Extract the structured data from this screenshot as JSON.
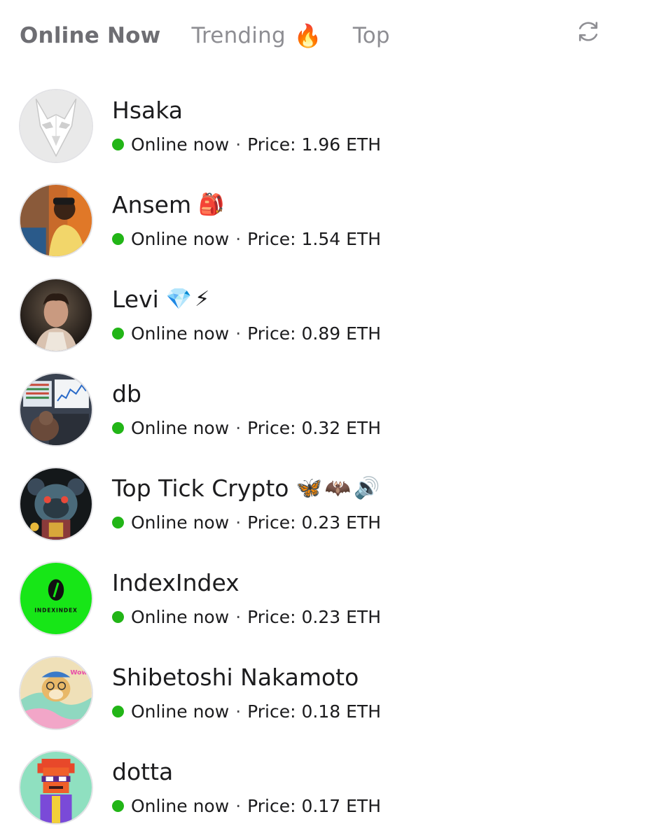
{
  "tabs": [
    {
      "label": "Online Now",
      "emoji": "",
      "active": true
    },
    {
      "label": "Trending",
      "emoji": "🔥",
      "active": false
    },
    {
      "label": "Top",
      "emoji": "",
      "active": false
    }
  ],
  "refresh_icon": "refresh-icon",
  "status_text": "Online now",
  "separator": "·",
  "price_prefix": "Price:",
  "colors": {
    "online_dot": "#22b517",
    "active_tab": "#6e6e73",
    "inactive_tab": "#8e8e93"
  },
  "users": [
    {
      "name": "Hsaka",
      "emojis": "",
      "price": "1.96 ETH"
    },
    {
      "name": "Ansem",
      "emojis": "🎒",
      "price": "1.54 ETH"
    },
    {
      "name": "Levi",
      "emojis": "💎⚡",
      "price": "0.89 ETH"
    },
    {
      "name": "db",
      "emojis": "",
      "price": "0.32 ETH"
    },
    {
      "name": "Top Tick Crypto",
      "emojis": "🦋🦇🔊",
      "price": "0.23 ETH"
    },
    {
      "name": "IndexIndex",
      "emojis": "",
      "price": "0.23 ETH",
      "avatar_text": "INDEXINDEX"
    },
    {
      "name": "Shibetoshi Nakamoto",
      "emojis": "",
      "price": "0.18 ETH",
      "avatar_text": "Wow"
    },
    {
      "name": "dotta",
      "emojis": "",
      "price": "0.17 ETH"
    }
  ]
}
